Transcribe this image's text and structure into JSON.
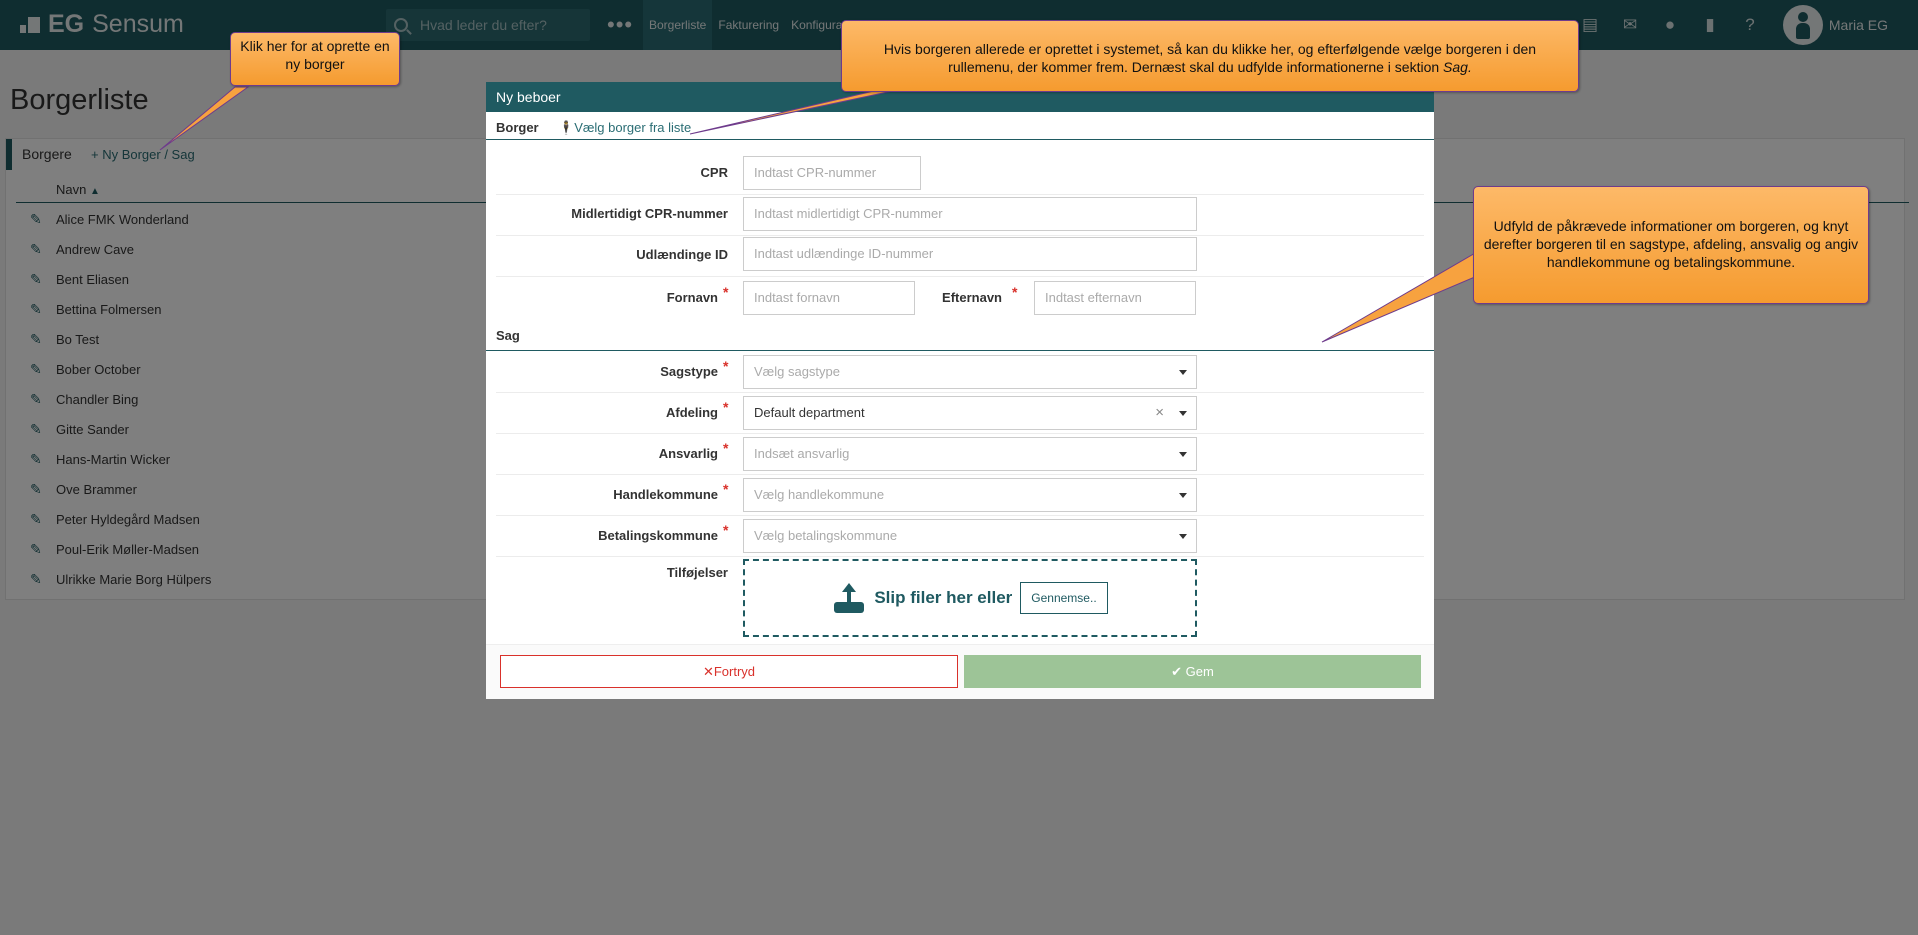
{
  "app": {
    "logo": {
      "brand": "EG",
      "product": "Sensum"
    },
    "search_placeholder": "Hvad leder du efter?",
    "more_icon": "ellipsis-icon",
    "nav": [
      "Borgerliste",
      "Fakturering",
      "Konfigurati"
    ],
    "top_icons": [
      "document-icon",
      "mail-icon",
      "chat-icon",
      "bookmark-icon",
      "help-icon"
    ],
    "user_name": "Maria EG"
  },
  "page": {
    "title": "Borgerliste",
    "panel_title": "Borgere",
    "new_link": "+ Ny Borger / Sag",
    "column_header": "Navn",
    "sort_icon": "sort-asc-icon",
    "rows": [
      "Alice FMK Wonderland",
      "Andrew Cave",
      "Bent Eliasen",
      "Bettina Folmersen",
      "Bo Test",
      "Bober October",
      "Chandler Bing",
      "Gitte Sander",
      "Hans-Martin Wicker",
      "Ove Brammer",
      "Peter Hyldegård Madsen",
      "Poul-Erik Møller-Madsen",
      "Ulrikke Marie Borg Hülpers"
    ]
  },
  "modal": {
    "title": "Ny beboer",
    "borger_section": "Borger",
    "pick_link": "Vælg borger fra liste",
    "fields": {
      "cpr_label": "CPR",
      "cpr_placeholder": "Indtast CPR-nummer",
      "temp_cpr_label": "Midlertidigt CPR-nummer",
      "temp_cpr_placeholder": "Indtast midlertidigt CPR-nummer",
      "foreign_id_label": "Udlændinge ID",
      "foreign_id_placeholder": "Indtast udlændinge ID-nummer",
      "first_name_label": "Fornavn",
      "first_name_placeholder": "Indtast fornavn",
      "last_name_label": "Efternavn",
      "last_name_placeholder": "Indtast efternavn"
    },
    "sag_section": "Sag",
    "sag_fields": {
      "casetype_label": "Sagstype",
      "casetype_placeholder": "Vælg sagstype",
      "department_label": "Afdeling",
      "department_value": "Default department",
      "responsible_label": "Ansvarlig",
      "responsible_placeholder": "Indsæt ansvarlig",
      "trade_muni_label": "Handlekommune",
      "trade_muni_placeholder": "Vælg handlekommune",
      "pay_muni_label": "Betalingskommune",
      "pay_muni_placeholder": "Vælg betalingskommune",
      "attachments_label": "Tilføjelser",
      "drop_text": "Slip filer her eller",
      "browse_label": "Gennemse.."
    },
    "required_mark": "*",
    "cancel_label": "Fortryd",
    "save_label": "Gem"
  },
  "callouts": {
    "new_citizen": "Klik her for at oprette en ny borger",
    "existing_citizen": "Hvis borgeren allerede er oprettet i systemet, så kan du klikke her, og efterfølgende vælge borgeren i den rullemenu, der kommer frem. Dernæst skal du udfylde informationerne i sektion",
    "existing_citizen_em": "Sag.",
    "fill_info": "Udfyld de påkrævede informationer om borgeren, og knyt derefter borgeren til en sagstype, afdeling, ansvalig og angiv handlekommune og betalingskommune."
  },
  "colors": {
    "primary": "#1f5a61",
    "required": "#d9312b",
    "save": "#9dc497",
    "callout": "#f7a23f"
  }
}
